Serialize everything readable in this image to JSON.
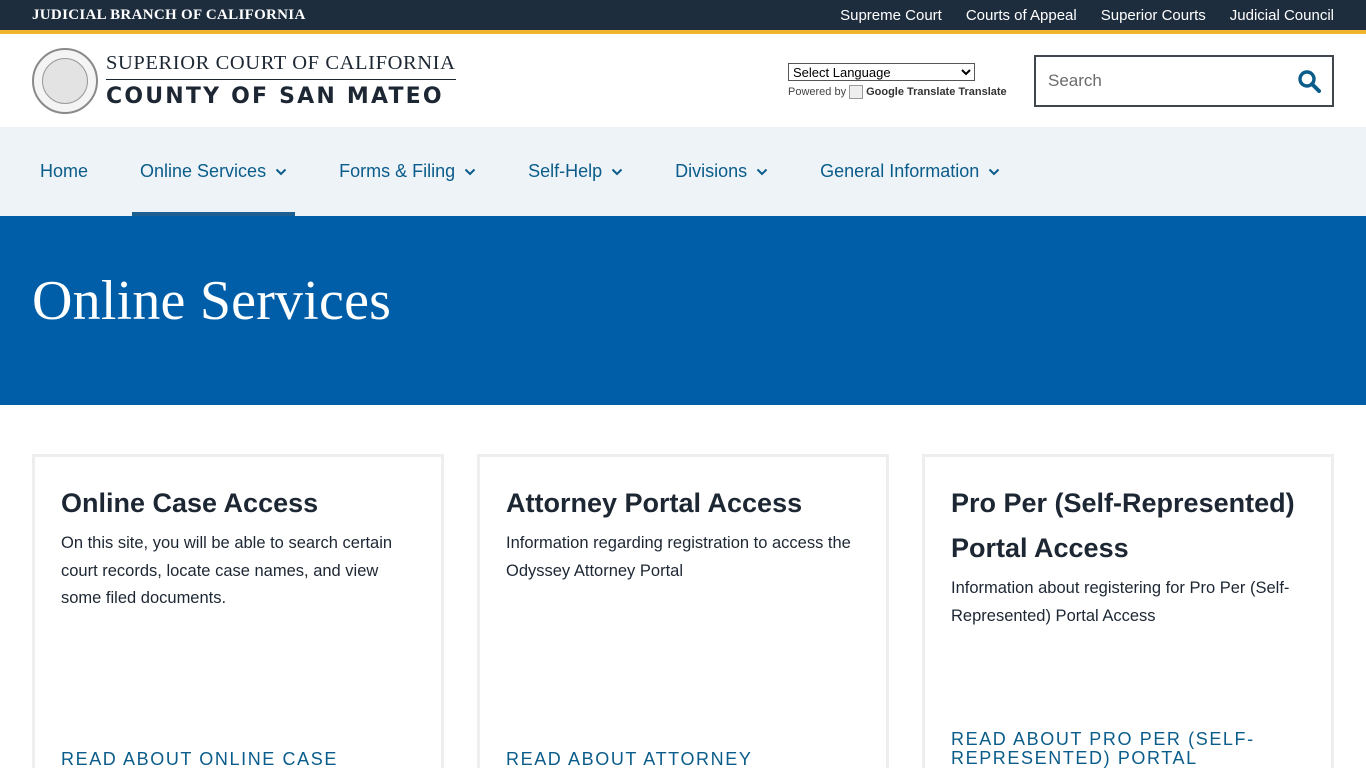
{
  "topbar": {
    "branch": "JUDICIAL BRANCH OF CALIFORNIA",
    "links": [
      "Supreme Court",
      "Courts of Appeal",
      "Superior Courts",
      "Judicial Council"
    ]
  },
  "header": {
    "court_line1": "SUPERIOR COURT OF CALIFORNIA",
    "court_line2": "COUNTY OF SAN MATEO",
    "translate_select": "Select Language",
    "powered_by": "Powered by",
    "google_translate": "Google Translate",
    "translate_word": "Translate",
    "search_placeholder": "Search"
  },
  "nav": {
    "items": [
      "Home",
      "Online Services",
      "Forms & Filing",
      "Self-Help",
      "Divisions",
      "General Information"
    ],
    "active": "Online Services"
  },
  "hero": {
    "title": "Online Services"
  },
  "cards": [
    {
      "title": "Online Case Access",
      "body": "On this site, you will be able to search certain court records, locate case names, and view some filed documents.",
      "link": "READ ABOUT ONLINE CASE"
    },
    {
      "title": "Attorney Portal Access",
      "body": "Information regarding registration to access the Odyssey Attorney Portal",
      "link": "READ ABOUT ATTORNEY"
    },
    {
      "title": "Pro Per (Self-Represented) Portal Access",
      "body": "Information about registering for Pro Per (Self-Represented) Portal Access",
      "link": "READ ABOUT PRO PER (SELF-REPRESENTED) PORTAL"
    }
  ],
  "colors": {
    "topbar_bg": "#1e2d3e",
    "accent_gold": "#f1b42f",
    "nav_bg": "#eef3f8",
    "link_blue": "#0a5c8a",
    "hero_blue": "#005ea8"
  }
}
